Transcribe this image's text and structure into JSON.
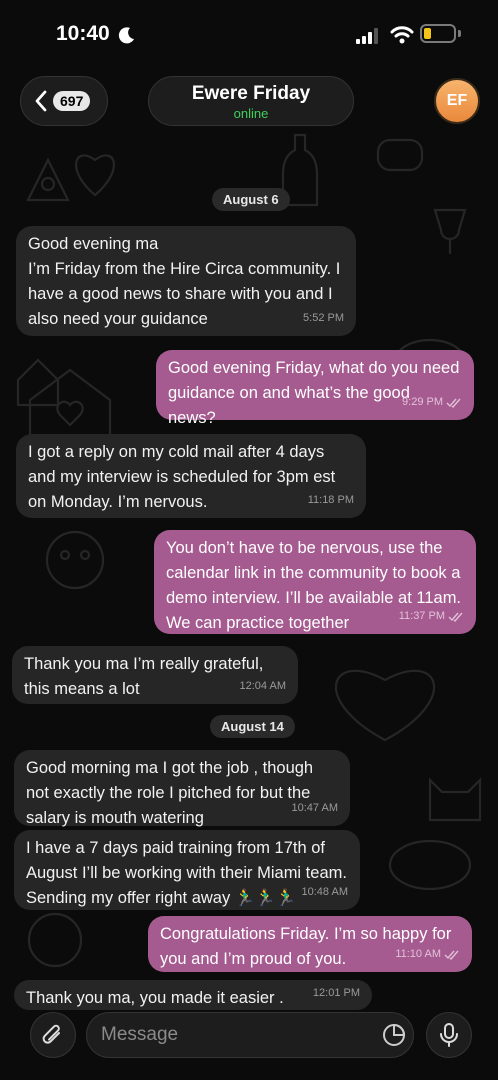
{
  "status_bar": {
    "time": "10:40"
  },
  "header": {
    "back_count": "697",
    "title": "Ewere Friday",
    "status": "online",
    "avatar_initials": "EF"
  },
  "messages": [
    {
      "type": "date",
      "text": "August 6"
    },
    {
      "type": "in",
      "text": "Good evening ma\nI’m Friday from the Hire Circa community. I have a good news to share with you and I also need your guidance",
      "time": "5:52 PM"
    },
    {
      "type": "out",
      "text": "Good evening Friday, what do you need guidance on and what’s the good news?",
      "time": "9:29 PM"
    },
    {
      "type": "in",
      "text": "I got a reply on my cold mail after 4 days and my interview is scheduled for 3pm est on Monday. I’m nervous.",
      "time": "11:18 PM"
    },
    {
      "type": "out",
      "text": "You don’t have to be nervous, use the calendar link in the community to book a demo interview. I’ll be available at 11am. We can practice together",
      "time": "11:37 PM"
    },
    {
      "type": "in",
      "text": "Thank you ma I’m really grateful, this means a lot",
      "time": "12:04 AM"
    },
    {
      "type": "date",
      "text": "August 14"
    },
    {
      "type": "in",
      "text": "Good morning ma I got the job , though not exactly the role I pitched for but the salary is mouth watering",
      "time": "10:47 AM"
    },
    {
      "type": "in",
      "text": "I have a 7 days paid training from 17th of August I’ll be working with their Miami team. Sending my offer right away 🏃‍♂️🏃‍♂️🏃‍♂️",
      "time": "10:48 AM"
    },
    {
      "type": "out",
      "text": "Congratulations Friday.  I’m so happy for you and I’m proud of you.",
      "time": "11:10 AM"
    },
    {
      "type": "in",
      "text": "Thank you ma, you made it easier .",
      "time": "12:01 PM"
    }
  ],
  "composer": {
    "placeholder": "Message"
  },
  "colors": {
    "outgoing": "#a55a90",
    "incoming": "#262626",
    "online": "#3fcf5b",
    "avatar": "#f0a058"
  },
  "icons": [
    "moon-icon",
    "signal-icon",
    "wifi-icon",
    "battery-icon",
    "chevron-left-icon",
    "paperclip-icon",
    "sticker-icon",
    "microphone-icon",
    "double-check-icon"
  ]
}
